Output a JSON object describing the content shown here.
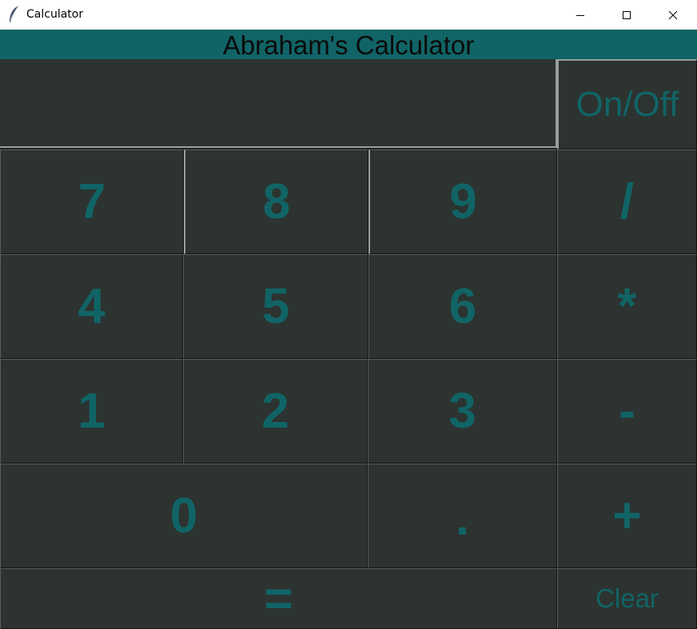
{
  "window": {
    "title": "Calculator",
    "icon": "feather-icon",
    "controls": [
      "minimize-icon",
      "maximize-icon",
      "close-icon"
    ]
  },
  "header": {
    "title": "Abraham's Calculator"
  },
  "display": {
    "value": ""
  },
  "keys": {
    "on_off": "On/Off",
    "seven": "7",
    "eight": "8",
    "nine": "9",
    "divide": "/",
    "four": "4",
    "five": "5",
    "six": "6",
    "multiply": "*",
    "one": "1",
    "two": "2",
    "three": "3",
    "subtract": "-",
    "zero": "0",
    "decimal": ".",
    "add": "+",
    "equals": "=",
    "clear": "Clear"
  },
  "colors": {
    "header_bg": "#116466",
    "key_bg": "#2c3330",
    "key_text": "#116466",
    "header_text": "#0b0b0b"
  }
}
